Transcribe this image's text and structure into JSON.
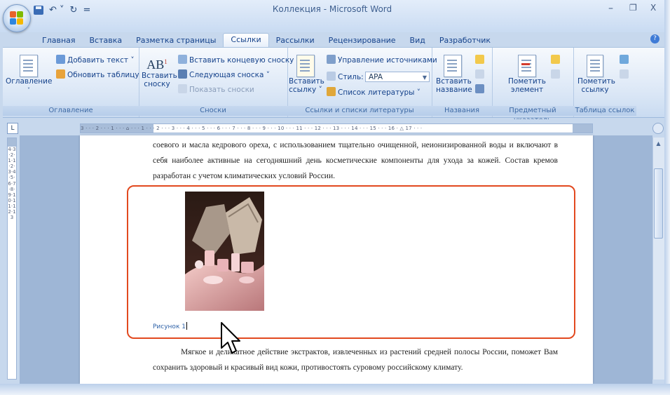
{
  "window": {
    "title": "Коллекция - Microsoft Word",
    "minimize": "–",
    "restore": "❐",
    "close": "X"
  },
  "quick_access": {
    "undo": "↶ ˅",
    "redo": "↻",
    "customize": "="
  },
  "tabs": [
    {
      "label": "Главная"
    },
    {
      "label": "Вставка"
    },
    {
      "label": "Разметка страницы"
    },
    {
      "label": "Ссылки",
      "active": true
    },
    {
      "label": "Рассылки"
    },
    {
      "label": "Рецензирование"
    },
    {
      "label": "Вид"
    },
    {
      "label": "Разработчик"
    }
  ],
  "ribbon": {
    "toc": {
      "label": "Оглавление",
      "button": "Оглавление",
      "add_text": "Добавить текст ˅",
      "update_table": "Обновить таблицу"
    },
    "footnotes": {
      "label": "Сноски",
      "insert": "Вставить\nсноску",
      "insert_line1": "Вставить",
      "insert_line2": "сноску",
      "ab_glyph": "AB",
      "ab_sup": "1",
      "endnote": "Вставить концевую сноску",
      "next": "Следующая сноска ˅",
      "show": "Показать сноски"
    },
    "citations": {
      "label": "Ссылки и списки литературы",
      "insert_line1": "Вставить",
      "insert_line2": "ссылку ˅",
      "manage": "Управление источниками",
      "style_label": "Стиль:",
      "style_value": "APA",
      "bibliography": "Список литературы ˅"
    },
    "captions": {
      "label": "Названия",
      "insert_line1": "Вставить",
      "insert_line2": "название"
    },
    "index": {
      "label": "Предметный указатель",
      "mark_line1": "Пометить",
      "mark_line2": "элемент"
    },
    "toa": {
      "label": "Таблица ссылок",
      "mark_line1": "Пометить",
      "mark_line2": "ссылку"
    }
  },
  "ruler": {
    "corner": "L",
    "horizontal": "3 · · · 2 · · · 1 · · · ⌂ · · · 1 · · · 2 · · · 3 · · · 4 · · · 5 · · · 6 · · · 7 · · · 8 · · · 9 · · · 10 · · · 11 · · · 12 · · · 13 · · · 14 · · · 15 · · · 16 · △ 17 · · ·",
    "vertical": "4·3·2·1·1·2·3·4·5·6·7·8·9·10·11·12·13"
  },
  "document": {
    "paragraph_top": "соевого и масла кедрового ореха, с использованием тщательно очищенной, неионизированной воды и включают в себя наиболее активные на сегодняшний день косметические компоненты для ухода за кожей. Состав кремов разработан с учетом климатических условий России.",
    "caption": "Рисунок 1",
    "paragraph_bottom": "Мягкое и деликатное действие экстрактов, извлеченных из растений средней полосы России, поможет Вам сохранить здоровый и красивый вид кожи, противостоять суровому российскому климату."
  },
  "colors": {
    "highlight_border": "#e2491f",
    "caption": "#2f62a8",
    "ribbon_text": "#15428b"
  }
}
